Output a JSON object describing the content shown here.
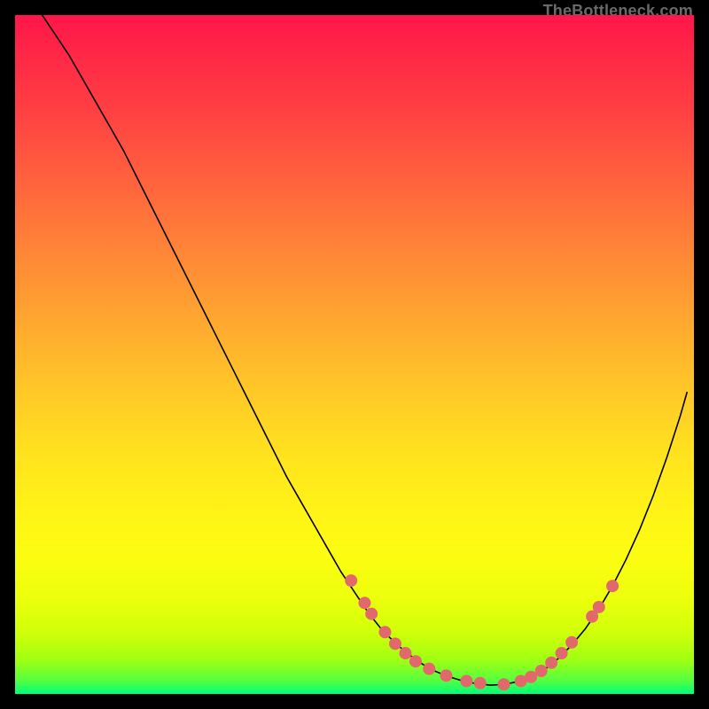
{
  "watermark": "TheBottleneck.com",
  "chart_data": {
    "type": "line",
    "title": "",
    "xlabel": "",
    "ylabel": "",
    "xlim": [
      0,
      100
    ],
    "ylim": [
      0,
      100
    ],
    "background": "gradient-red-yellow-green",
    "curve": {
      "x": [
        4,
        6,
        8,
        10,
        12,
        14,
        16,
        18,
        20,
        22,
        24,
        26,
        28,
        30,
        32,
        34,
        36,
        38,
        40,
        42,
        44,
        46,
        48,
        50,
        52,
        54,
        56,
        58,
        60,
        62,
        64,
        66,
        68,
        70,
        72,
        74,
        76,
        78,
        80,
        82,
        84,
        86,
        88,
        90,
        92,
        94,
        96,
        98,
        99
      ],
      "y": [
        100,
        97,
        94,
        90.5,
        87,
        83.5,
        80,
        76,
        72,
        68,
        64,
        60,
        56,
        52,
        48,
        44,
        40,
        36,
        32,
        28.5,
        25,
        21.5,
        18,
        15,
        12,
        9.5,
        7.5,
        5.8,
        4.4,
        3.3,
        2.5,
        1.9,
        1.5,
        1.3,
        1.4,
        1.8,
        2.5,
        3.6,
        5.2,
        7.2,
        9.6,
        12.5,
        15.9,
        19.8,
        24.2,
        29.2,
        34.8,
        41,
        44.5
      ]
    },
    "markers": {
      "color": "#e2696b",
      "radius": 7,
      "points": [
        {
          "x": 49.5,
          "y": 16.7
        },
        {
          "x": 51.5,
          "y": 13.4
        },
        {
          "x": 52.5,
          "y": 11.8
        },
        {
          "x": 54.5,
          "y": 9.1
        },
        {
          "x": 56.0,
          "y": 7.4
        },
        {
          "x": 57.5,
          "y": 6.0
        },
        {
          "x": 59.0,
          "y": 4.8
        },
        {
          "x": 61.0,
          "y": 3.7
        },
        {
          "x": 63.5,
          "y": 2.7
        },
        {
          "x": 66.5,
          "y": 1.9
        },
        {
          "x": 68.5,
          "y": 1.6
        },
        {
          "x": 72.0,
          "y": 1.4
        },
        {
          "x": 74.5,
          "y": 1.9
        },
        {
          "x": 76.0,
          "y": 2.5
        },
        {
          "x": 77.5,
          "y": 3.4
        },
        {
          "x": 79.0,
          "y": 4.6
        },
        {
          "x": 80.5,
          "y": 6.0
        },
        {
          "x": 82.0,
          "y": 7.6
        },
        {
          "x": 85.0,
          "y": 11.4
        },
        {
          "x": 86.0,
          "y": 12.8
        },
        {
          "x": 88.0,
          "y": 15.9
        }
      ]
    },
    "gradient_stops": [
      {
        "offset": 0.0,
        "color": "#ff1649"
      },
      {
        "offset": 0.07,
        "color": "#ff2b46"
      },
      {
        "offset": 0.15,
        "color": "#ff4342"
      },
      {
        "offset": 0.25,
        "color": "#ff643d"
      },
      {
        "offset": 0.35,
        "color": "#ff8637"
      },
      {
        "offset": 0.45,
        "color": "#ffa730"
      },
      {
        "offset": 0.55,
        "color": "#ffc728"
      },
      {
        "offset": 0.65,
        "color": "#ffe31e"
      },
      {
        "offset": 0.73,
        "color": "#fff317"
      },
      {
        "offset": 0.8,
        "color": "#fcfd11"
      },
      {
        "offset": 0.86,
        "color": "#ecff0c"
      },
      {
        "offset": 0.91,
        "color": "#d0ff09"
      },
      {
        "offset": 0.95,
        "color": "#9fff12"
      },
      {
        "offset": 0.98,
        "color": "#56ff3f"
      },
      {
        "offset": 1.0,
        "color": "#00ff7b"
      }
    ]
  }
}
